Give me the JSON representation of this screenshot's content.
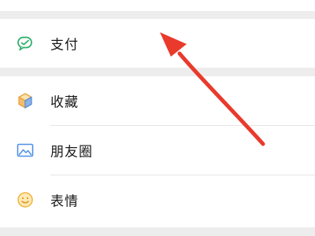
{
  "menu": {
    "items": [
      {
        "label": "支付",
        "icon": "wechat-pay-icon"
      },
      {
        "label": "收藏",
        "icon": "favorites-cube-icon"
      },
      {
        "label": "朋友圈",
        "icon": "moments-picture-icon"
      },
      {
        "label": "表情",
        "icon": "sticker-smiley-icon"
      }
    ]
  },
  "colors": {
    "background": "#ededed",
    "card": "#ffffff",
    "text": "#191919",
    "pay_green": "#2aae67",
    "annotation_arrow": "#e93a2c"
  }
}
